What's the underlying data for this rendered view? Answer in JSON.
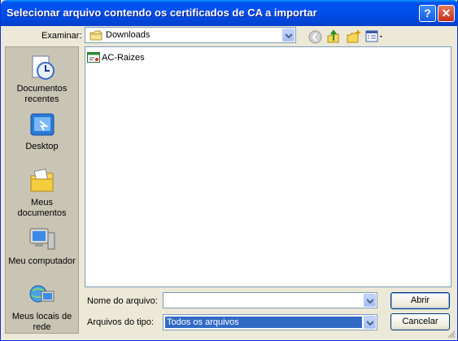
{
  "window": {
    "title": "Selecionar arquivo contendo os certificados de CA a importar",
    "help_label": "?",
    "close_label": "✕"
  },
  "lookin": {
    "label": "Examinar:",
    "value": "Downloads"
  },
  "places": [
    {
      "label": "Documentos recentes"
    },
    {
      "label": "Desktop"
    },
    {
      "label": "Meus documentos"
    },
    {
      "label": "Meu computador"
    },
    {
      "label": "Meus locais de rede"
    }
  ],
  "files": [
    {
      "name": "AC-Raizes",
      "icon": "certificate-file-icon"
    }
  ],
  "filename": {
    "label": "Nome do arquivo:",
    "value": ""
  },
  "filetype": {
    "label": "Arquivos do tipo:",
    "value": "Todos os arquivos"
  },
  "buttons": {
    "open": "Abrir",
    "cancel": "Cancelar"
  },
  "colors": {
    "title_bar": "#0053ee",
    "selection": "#316ac5",
    "window_bg": "#ece9d8"
  }
}
